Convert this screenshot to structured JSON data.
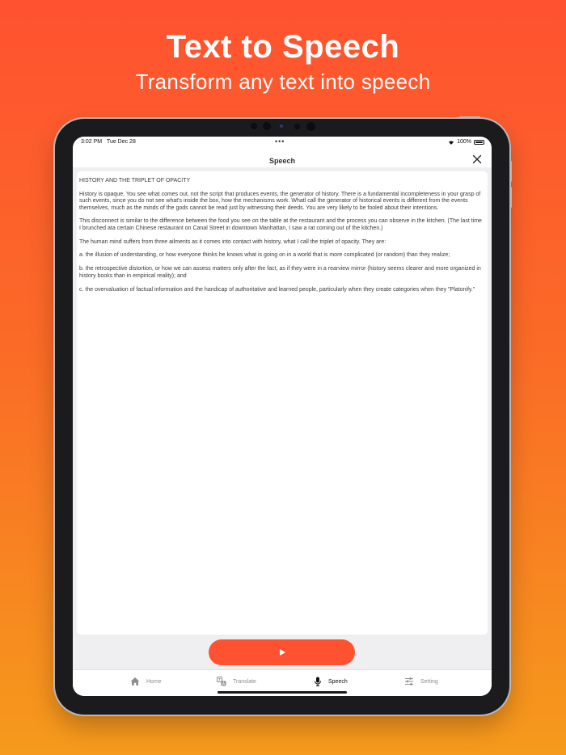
{
  "promo": {
    "headline": "Text to Speech",
    "subhead": "Transform any text into speech"
  },
  "status_bar": {
    "time": "3:02 PM",
    "date": "Tue Dec 28",
    "more": "•••",
    "battery": "100%"
  },
  "nav": {
    "title": "Speech"
  },
  "document": {
    "text": "HISTORY AND THE TRIPLET OF OPACITY\n\nHistory is opaque. You see what comes out, not the script that produces events, the generator of history. There is a fundamental incompleteness in your grasp of such events, since you do not see what's inside the box, how the mechanisms work. Whatl call the generator of historical events is different from the events themselves, much as the minds of the gods cannot be read just by witnessing their deeds. You are very likely to be fooled about their intentions.\n\nThis disconnect is similar to the difference between the food you see on the table at the restaurant and the process you can observe in the kitchen. (The last time I brunched ata certain Chinese restaurant on Canal Street in downtown Manhattan, I saw a rat coming out of the kitchen.)\n\nThe human mind suffers from three ailments as it comes into contact with history, what I call the triplet of opacity. They are:\n\na. the illusion of understanding, or how everyone thinks he knows what is going on in a world that is more complicated (or random) than they realize;\n\nb. the retrospective distortion, or how we can assess matters only after the fact, as if they were in a rearview mirror (history seems clearer and more organized in history books than in empirical reality); and\n\nc. the overvaluation of factual information and the handicap of authoritative and learned people, particularly when they create categories when they \"Platonify.\""
  },
  "player": {
    "play_icon": "play-icon"
  },
  "tabs": [
    {
      "label": "Home",
      "icon": "home-icon"
    },
    {
      "label": "Translate",
      "icon": "translate-icon"
    },
    {
      "label": "Speech",
      "icon": "microphone-icon",
      "active": true
    },
    {
      "label": "Setting",
      "icon": "sliders-icon"
    }
  ],
  "colors": {
    "accent": "#ff5230",
    "background_top": "#ff5230",
    "background_bottom": "#f59a1c"
  }
}
